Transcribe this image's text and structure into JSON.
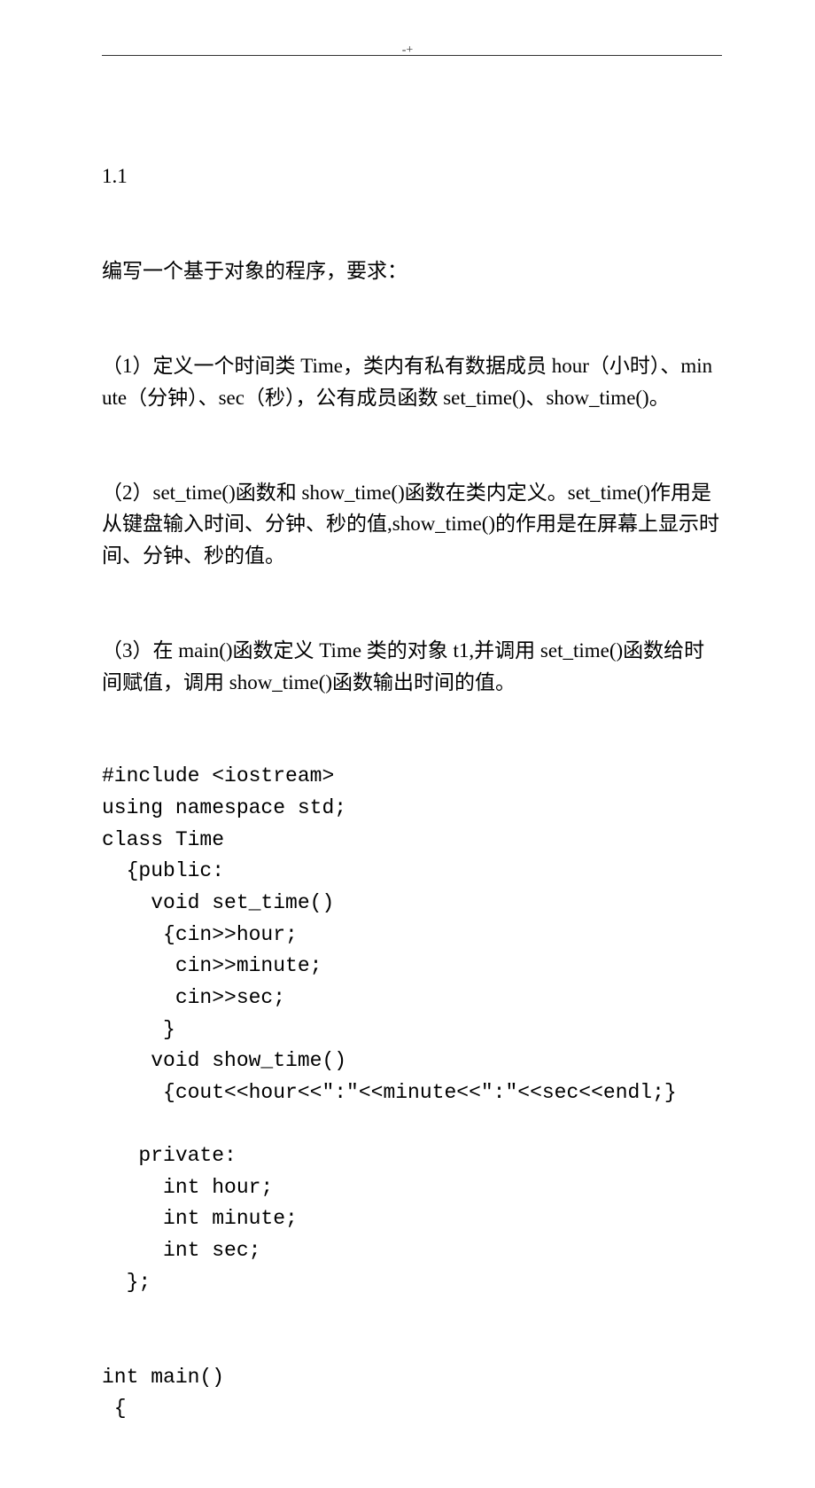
{
  "header": {
    "mark": "-+"
  },
  "body": {
    "section_number": "1.1",
    "intro": "编写一个基于对象的程序，要求：",
    "p1": "（1）定义一个时间类 Time，类内有私有数据成员 hour（小时）、minute（分钟）、sec（秒），公有成员函数 set_time()、show_time()。",
    "p2": "（2）set_time()函数和 show_time()函数在类内定义。set_time()作用是从键盘输入时间、分钟、秒的值,show_time()的作用是在屏幕上显示时间、分钟、秒的值。",
    "p3": "（3）在 main()函数定义 Time 类的对象 t1,并调用 set_time()函数给时间赋值，调用 show_time()函数输出时间的值。",
    "code": "#include <iostream>\nusing namespace std;\nclass Time\n  {public:\n    void set_time()\n     {cin>>hour;\n      cin>>minute;\n      cin>>sec;\n     }\n    void show_time()\n     {cout<<hour<<\":\"<<minute<<\":\"<<sec<<endl;}\n\n   private:\n     int hour;\n     int minute;\n     int sec;\n  };\n\n\nint main()\n {"
  }
}
